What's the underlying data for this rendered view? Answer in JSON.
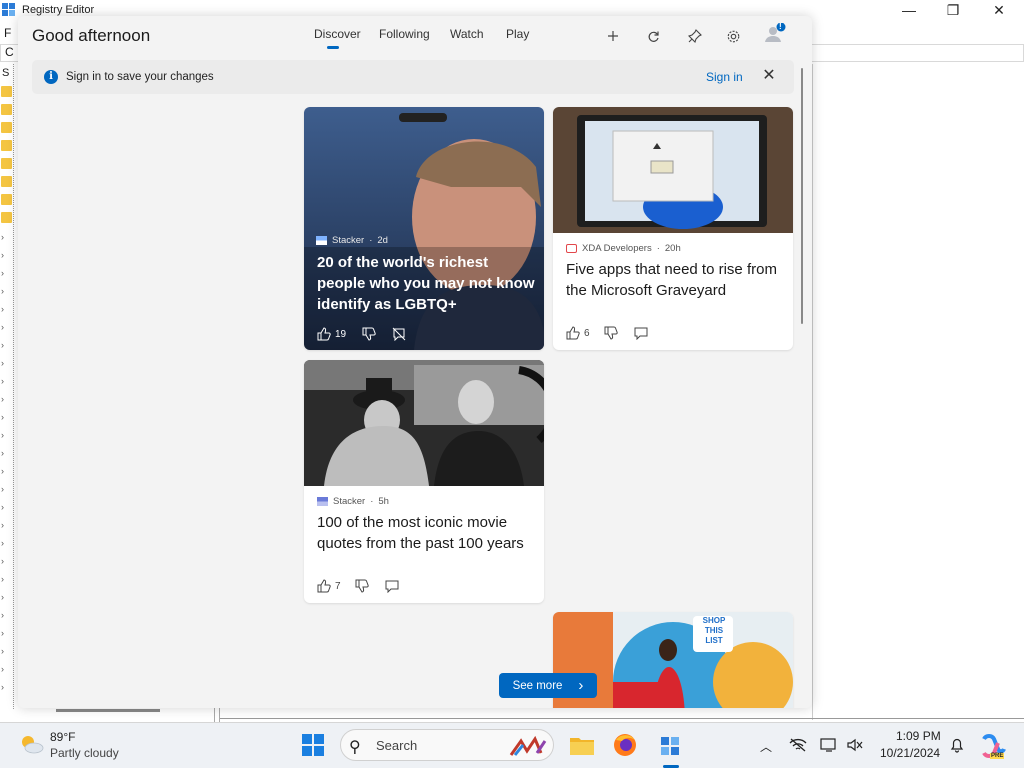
{
  "regedit": {
    "title": "Registry Editor",
    "menu_first_letter": "F",
    "address_first_letter": "C",
    "tree_first_letter": "S",
    "window_controls": {
      "minimize": "—",
      "maximize": "❐",
      "close": "✕"
    }
  },
  "widgets": {
    "greeting": "Good afternoon",
    "tabs": [
      {
        "label": "Discover",
        "active": true
      },
      {
        "label": "Following",
        "active": false
      },
      {
        "label": "Watch",
        "active": false
      },
      {
        "label": "Play",
        "active": false
      }
    ],
    "header_icons": [
      "add-icon",
      "refresh-icon",
      "pin-icon",
      "settings-icon",
      "profile-icon"
    ],
    "profile_badge": "!",
    "banner": {
      "text": "Sign in to save your changes",
      "signin_label": "Sign in",
      "close_glyph": "✕"
    },
    "cards": [
      {
        "source": "Stacker",
        "age": "2d",
        "headline": "20 of the world's richest people who you may not know identify as LGBTQ+",
        "likes": "19"
      },
      {
        "source": "XDA Developers",
        "age": "20h",
        "headline": "Five apps that need to rise from the Microsoft Graveyard",
        "likes": "6"
      },
      {
        "source": "Stacker",
        "age": "5h",
        "headline": "100 of the most iconic movie quotes from the past 100 years",
        "likes": "7"
      },
      {
        "image_text": "SHOP THIS LIST"
      }
    ],
    "see_more_label": "See more",
    "see_more_chevron": "›"
  },
  "taskbar": {
    "weather_temp": "89°F",
    "weather_condition": "Partly cloudy",
    "search_placeholder": "Search",
    "apps": [
      "start-icon",
      "search-icon",
      "copilot-art-icon",
      "file-explorer-icon",
      "firefox-icon",
      "registry-editor-icon"
    ],
    "tray_chevron": "︿",
    "time": "1:09 PM",
    "date": "10/21/2024",
    "copilot_badge": "PRE"
  },
  "colors": {
    "accent": "#0067c0",
    "panel_bg": "#f3f3f3",
    "taskbar_bg": "#eef1f5"
  }
}
